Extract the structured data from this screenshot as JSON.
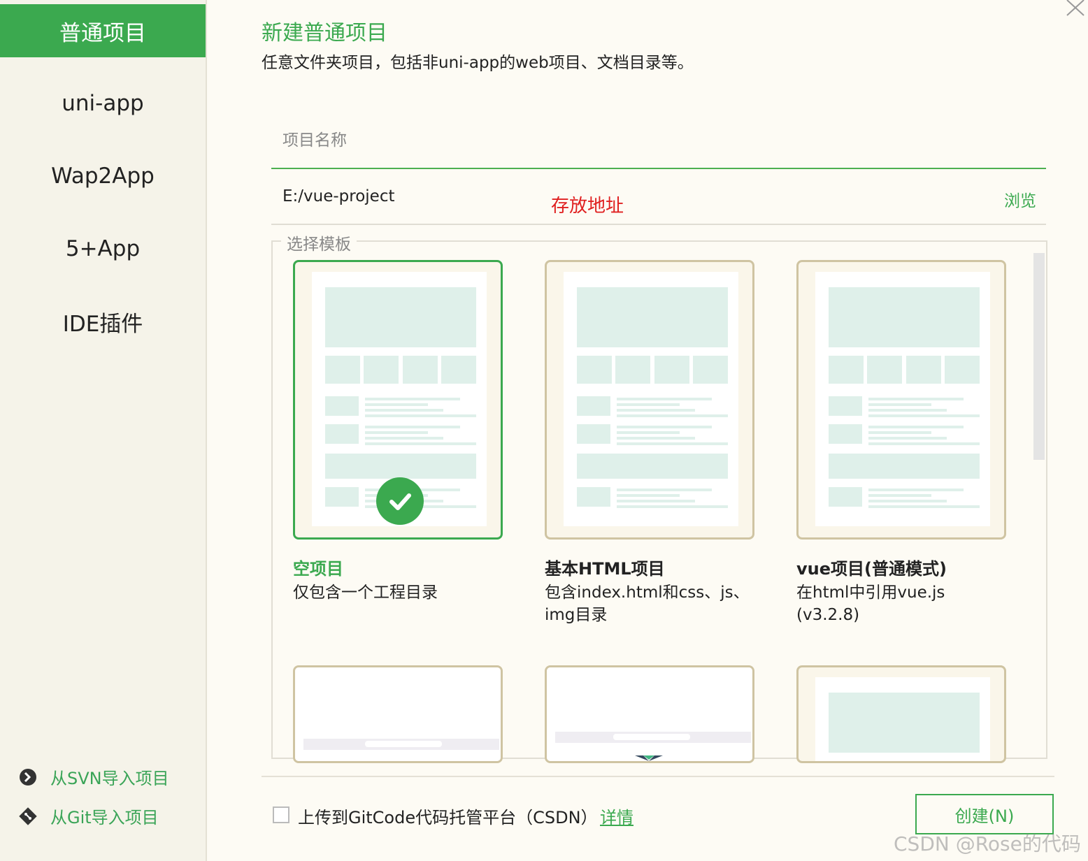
{
  "sidebar": {
    "items": [
      {
        "label": "普通项目",
        "active": true
      },
      {
        "label": "uni-app"
      },
      {
        "label": "Wap2App"
      },
      {
        "label": "5+App"
      },
      {
        "label": "IDE插件"
      }
    ],
    "import_svn": "从SVN导入项目",
    "import_git": "从Git导入项目"
  },
  "header": {
    "title": "新建普通项目",
    "subtitle": "任意文件夹项目，包括非uni-app的web项目、文档目录等。"
  },
  "form": {
    "name_placeholder": "项目名称",
    "path_value": "E:/vue-project",
    "path_annotation": "存放地址",
    "browse": "浏览"
  },
  "templates": {
    "legend": "选择模板",
    "items": [
      {
        "name": "空项目",
        "desc": "仅包含一个工程目录",
        "selected": true
      },
      {
        "name": "基本HTML项目",
        "desc": "包含index.html和css、js、img目录"
      },
      {
        "name": "vue项目(普通模式)",
        "desc": "在html中引用vue.js (v3.2.8)"
      }
    ]
  },
  "footer": {
    "upload_label": "上传到GitCode代码托管平台（CSDN）",
    "details": "详情",
    "create": "创建(N)"
  },
  "watermark": "CSDN @Rose的代码",
  "colors": {
    "accent": "#3ba94f",
    "annotation": "#e02020",
    "card_border": "#cfc4a2"
  }
}
